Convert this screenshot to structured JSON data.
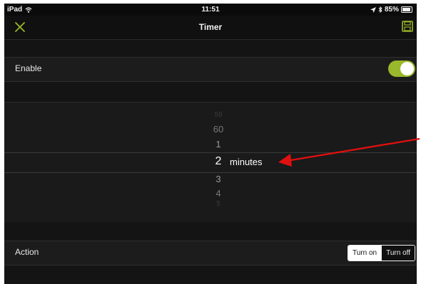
{
  "status_bar": {
    "device": "iPad",
    "time": "11:51",
    "battery": "85%",
    "icons": [
      "wifi-icon",
      "location-icon",
      "bluetooth-icon",
      "battery-icon"
    ]
  },
  "nav": {
    "title": "Timer",
    "close_icon": "close-icon",
    "save_icon": "save-icon"
  },
  "enable_row": {
    "label": "Enable",
    "toggle_on": true
  },
  "picker": {
    "items_above": [
      "59",
      "60",
      "1"
    ],
    "selected": "2",
    "unit": "minutes",
    "items_below": [
      "3",
      "4",
      "5"
    ]
  },
  "action_row": {
    "label": "Action",
    "options": [
      "Turn on",
      "Turn off"
    ],
    "selected": "Turn on"
  },
  "colors": {
    "accent": "#9ab82b",
    "background": "#0b0b0b",
    "annotation_arrow": "#e01010"
  }
}
